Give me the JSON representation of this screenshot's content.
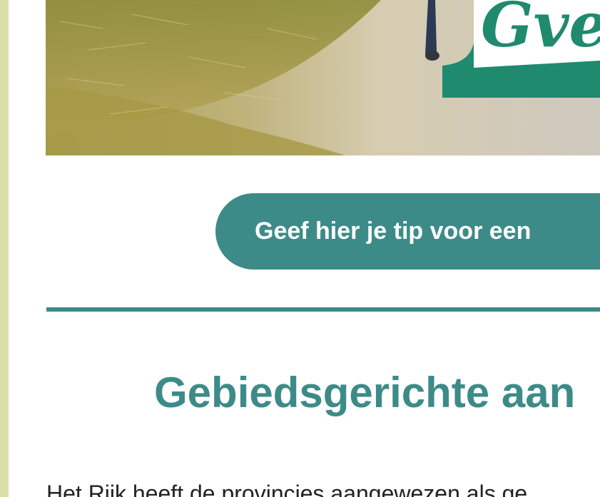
{
  "hero": {
    "image_description_icon": "farm-hay-photo",
    "logo_fragment": "Gve"
  },
  "cta": {
    "label": "Geef hier je tip voor een"
  },
  "section": {
    "heading": "Gebiedsgerichte aan",
    "body_text": "Het Rijk heeft de provincies aangewezen als ge"
  },
  "colors": {
    "accent": "#3d8b88",
    "left_strip": "#d8e0a8",
    "logo_green": "#1f8a6e"
  }
}
